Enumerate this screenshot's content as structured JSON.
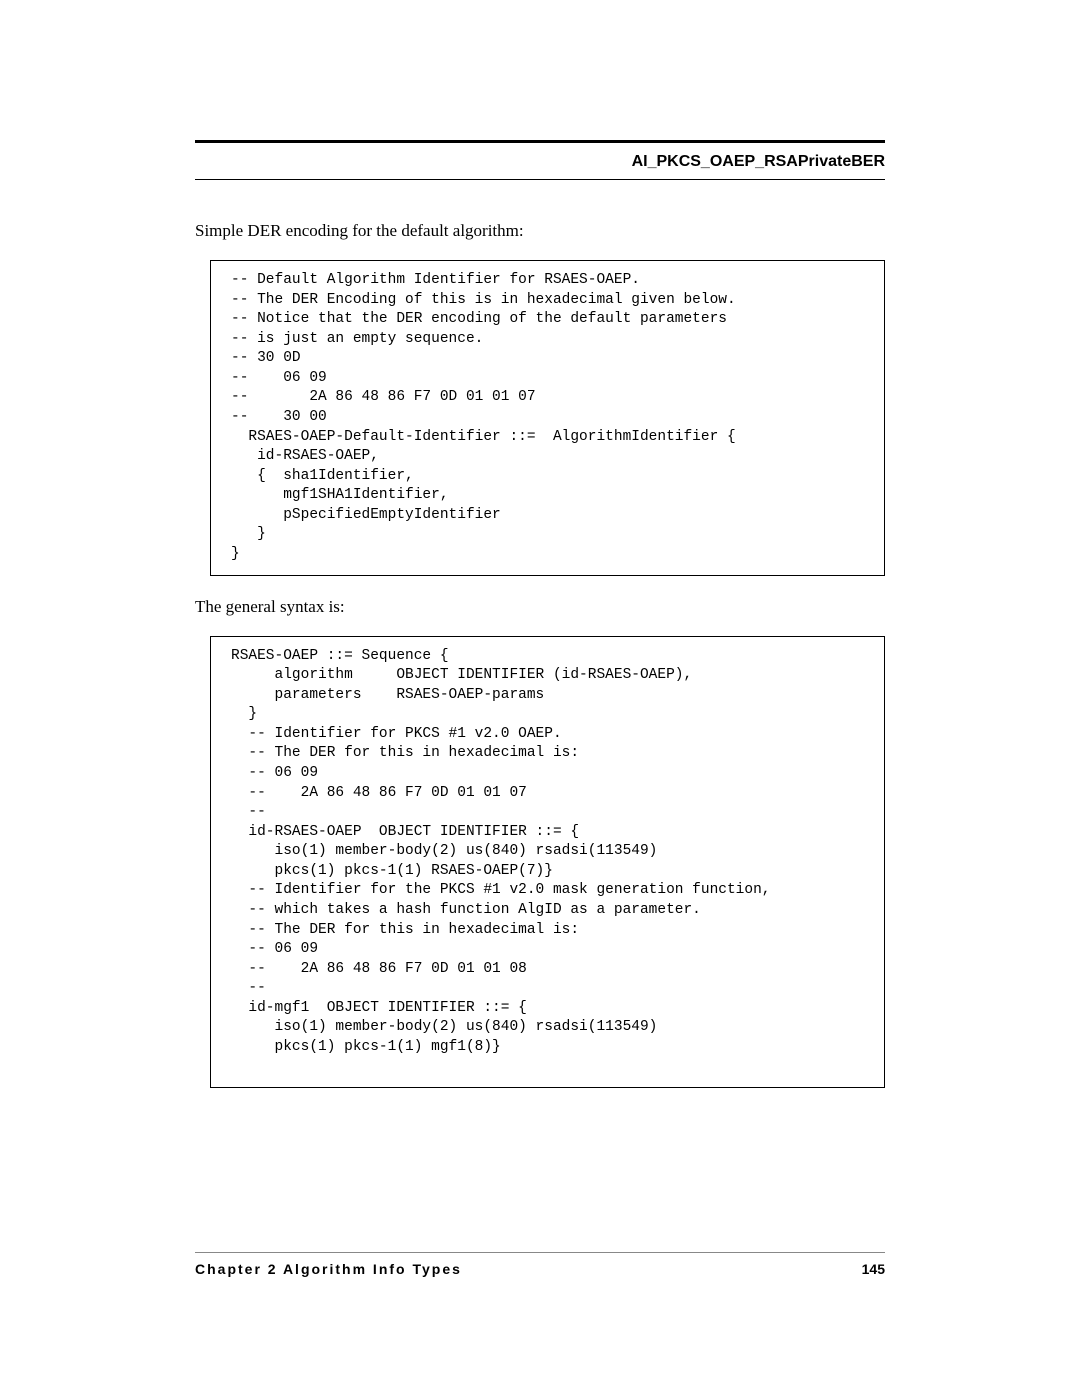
{
  "header": {
    "title": "AI_PKCS_OAEP_RSAPrivateBER"
  },
  "body": {
    "intro1": "Simple DER encoding for the default algorithm:",
    "code1": "-- Default Algorithm Identifier for RSAES-OAEP.\n-- The DER Encoding of this is in hexadecimal given below.\n-- Notice that the DER encoding of the default parameters\n-- is just an empty sequence.\n-- 30 0D\n--    06 09\n--       2A 86 48 86 F7 0D 01 01 07\n--    30 00\n  RSAES-OAEP-Default-Identifier ::=  AlgorithmIdentifier {\n   id-RSAES-OAEP,\n   {  sha1Identifier,\n      mgf1SHA1Identifier,\n      pSpecifiedEmptyIdentifier\n   }\n}",
    "intro2": "The general syntax is:",
    "code2": "RSAES-OAEP ::= Sequence {\n     algorithm     OBJECT IDENTIFIER (id-RSAES-OAEP),\n     parameters    RSAES-OAEP-params\n  }\n  -- Identifier for PKCS #1 v2.0 OAEP.\n  -- The DER for this in hexadecimal is:\n  -- 06 09\n  --    2A 86 48 86 F7 0D 01 01 07\n  --\n  id-RSAES-OAEP  OBJECT IDENTIFIER ::= {\n     iso(1) member-body(2) us(840) rsadsi(113549)\n     pkcs(1) pkcs-1(1) RSAES-OAEP(7)}\n  -- Identifier for the PKCS #1 v2.0 mask generation function,\n  -- which takes a hash function AlgID as a parameter.\n  -- The DER for this in hexadecimal is:\n  -- 06 09\n  --    2A 86 48 86 F7 0D 01 01 08\n  --\n  id-mgf1  OBJECT IDENTIFIER ::= {\n     iso(1) member-body(2) us(840) rsadsi(113549)\n     pkcs(1) pkcs-1(1) mgf1(8)}\n\n"
  },
  "footer": {
    "chapter": "Chapter 2  Algorithm Info Types",
    "page": "145"
  }
}
